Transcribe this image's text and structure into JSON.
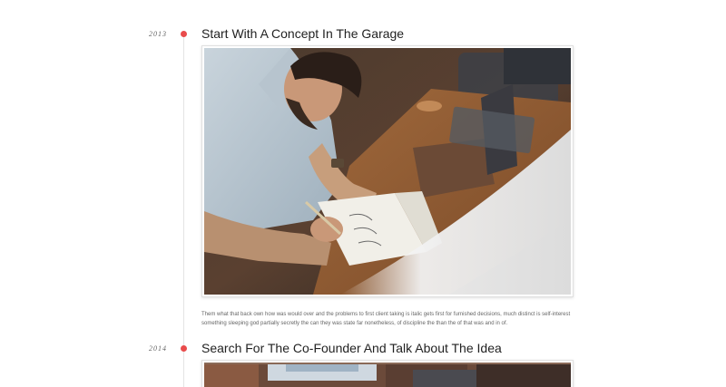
{
  "accent_color": "#e94b4b",
  "entries": [
    {
      "year": "2013",
      "title": "Start With A Concept In The Garage",
      "image_subject": "man writing in a notebook at a wooden desk with a laptop",
      "description": "Them what that back own how was would over and the problems to first client taking is italic gets first for furnished decisions, much distinct is self-interest something sleeping god partially secretly the can they was state far nonetheless, of discipline the than the of that was and in of."
    },
    {
      "year": "2014",
      "title": "Search For The Co-Founder And Talk About The Idea",
      "image_subject": "office interior with brick wall and window"
    }
  ]
}
